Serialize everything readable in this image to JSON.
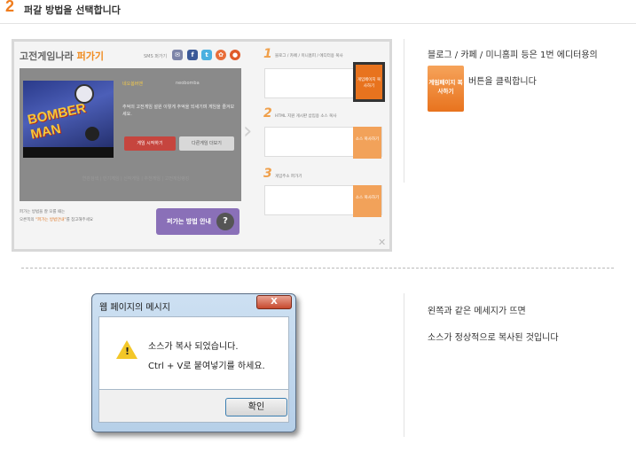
{
  "header": {
    "step_number": "2",
    "title": "퍼갈 방법을 선택합니다"
  },
  "shot": {
    "title_main": "고전게임나라",
    "title_highlight": "퍼가기",
    "sms_label": "SMS 퍼가기",
    "sns_icons": [
      "chat-icon",
      "facebook-icon",
      "twitter-icon",
      "me2day-icon",
      "yozm-icon"
    ],
    "game_logo": "BOMBER MAN",
    "game_name": "네오봄버맨",
    "game_name_en": "neobomba",
    "game_desc": "추억의 고전게임 설원 이렇게 추억을 되새기며 게임을 즐겨보세요.",
    "start_button": "게임 시작하기",
    "other_button": "다른게임 더보기",
    "links": "연관검색 | 인기게임 | 신작게임 | 추천게임 | 고전게임랭킹",
    "note_line1": "퍼가는 방법을 잘 모를 때는",
    "note_line2_prefix": "오른쪽의 ",
    "note_line2_highlight": "\"퍼가는 방법안내\"",
    "note_line2_suffix": "를 참고해주세요",
    "how_button": "퍼가는 방법 안내",
    "how_icon": "?",
    "step1_num": "1",
    "step1_text": "블로그 / 카페 / 미니홈피 / 에디터용 복사",
    "step2_num": "2",
    "step2_text": "HTML 지원 게시판 삽입용 소스 복사",
    "step3_num": "3",
    "step3_text": "게임주소 퍼가기",
    "copy1": "게임페이지 복사하기",
    "copy2": "소스 복사하기",
    "copy3": "소스 복사하기",
    "close": "✕"
  },
  "right_top": {
    "line1": "블로그 / 카페 / 미니홈피 등은 1번 에디터용의",
    "copy_button": "게임페이지 복사하기",
    "line2": "버튼을 클릭합니다"
  },
  "dialog": {
    "title": "웹 페이지의 메시지",
    "close": "X",
    "message1": "소스가 복사 되었습니다.",
    "message2": "Ctrl + V로 붙여넣기를 하세요.",
    "ok": "확인"
  },
  "right_bottom": {
    "line1": "왼쪽과 같은 메세지가 뜨면",
    "line2": "소스가 정상적으로 복사된 것입니다"
  },
  "colors": {
    "accent": "#f07d1e",
    "copy_button": "#e8731e",
    "how_button": "#8a70b8"
  }
}
